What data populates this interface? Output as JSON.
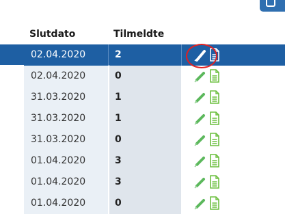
{
  "header": {
    "slutdato": "Slutdato",
    "tilmeldte": "Tilmeldte"
  },
  "colors": {
    "selected_row": "#1e5fa3",
    "date_cell": "#eaf0f6",
    "count_cell": "#dfe5ec",
    "edit_icon": "#4caf50",
    "highlight": "#e02020"
  },
  "rows": [
    {
      "date": "02.04.2020",
      "count": "2",
      "selected": true
    },
    {
      "date": "02.04.2020",
      "count": "0"
    },
    {
      "date": "31.03.2020",
      "count": "1"
    },
    {
      "date": "31.03.2020",
      "count": "1"
    },
    {
      "date": "31.03.2020",
      "count": "0"
    },
    {
      "date": "01.04.2020",
      "count": "3"
    },
    {
      "date": "01.04.2020",
      "count": "3"
    },
    {
      "date": "01.04.2020",
      "count": "0"
    }
  ],
  "icons": {
    "edit": "pencil-edit-icon",
    "document": "document-icon"
  }
}
